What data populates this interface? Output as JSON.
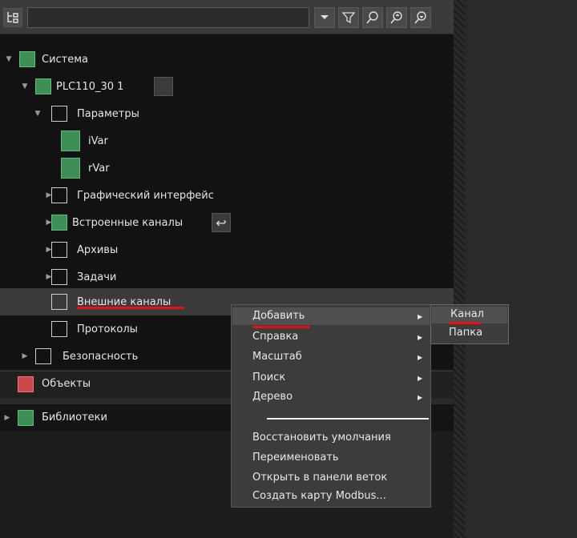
{
  "tree": {
    "system": "Система",
    "plc": "PLC110_30 1",
    "params": "Параметры",
    "ivar": "iVar",
    "rvar": "rVar",
    "gui": "Графический интерфейс",
    "builtin": "Встроенные каналы",
    "archives": "Архивы",
    "tasks": "Задачи",
    "external": "Внешние каналы",
    "protocols": "Протоколы",
    "security": "Безопасность"
  },
  "panels": {
    "objects": "Объекты",
    "libraries": "Библиотеки"
  },
  "context_menu": {
    "items": [
      "Добавить",
      "Справка",
      "Масштаб",
      "Поиск",
      "Дерево"
    ],
    "actions": [
      "Восстановить умолчания",
      "Переименовать",
      "Открыть в панели веток",
      "Создать карту Modbus..."
    ]
  },
  "submenu": {
    "items": [
      "Канал",
      "Папка"
    ]
  },
  "toolbar": {
    "search_value": ""
  },
  "colors": {
    "accent_green": "#3e8f56",
    "highlight_red": "#e81010"
  }
}
